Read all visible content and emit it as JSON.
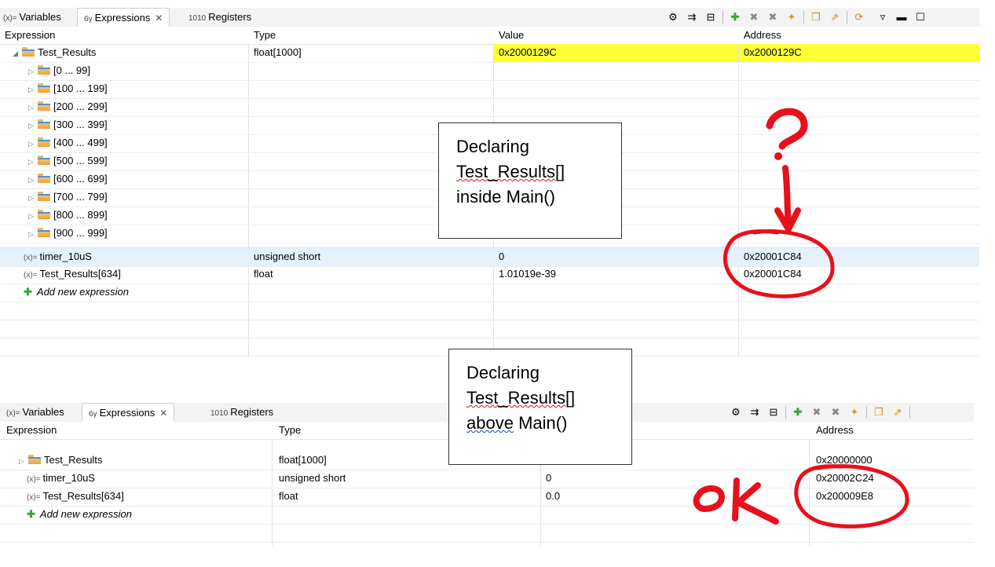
{
  "top_panel": {
    "tabs": [
      {
        "label": "Variables",
        "icon": "(x)="
      },
      {
        "label": "Expressions",
        "icon": "6γ"
      },
      {
        "label": "Registers",
        "icon": "1010"
      }
    ],
    "close_glyph": "✕",
    "columns": [
      "Expression",
      "Type",
      "Value",
      "Address"
    ],
    "rows": [
      {
        "expr": "Test_Results",
        "type": "float[1000]",
        "value": "0x2000129C",
        "address": "0x2000129C"
      },
      {
        "expr": "[0 ... 99]"
      },
      {
        "expr": "[100 ... 199]"
      },
      {
        "expr": "[200 ... 299]"
      },
      {
        "expr": "[300 ... 399]"
      },
      {
        "expr": "[400 ... 499]"
      },
      {
        "expr": "[500 ... 599]"
      },
      {
        "expr": "[600 ... 699]"
      },
      {
        "expr": "[700 ... 799]"
      },
      {
        "expr": "[800 ... 899]"
      },
      {
        "expr": "[900 ... 999]"
      },
      {
        "expr": "timer_10uS",
        "type": "unsigned short",
        "value": "0",
        "address": "0x20001C84"
      },
      {
        "expr": "Test_Results[634]",
        "type": "float",
        "value": "1.01019e-39",
        "address": "0x20001C84"
      }
    ],
    "add_label": "Add new expression"
  },
  "bottom_panel": {
    "tabs": [
      {
        "label": "Variables",
        "icon": "(x)="
      },
      {
        "label": "Expressions",
        "icon": "6γ"
      },
      {
        "label": "Registers",
        "icon": "1010"
      }
    ],
    "close_glyph": "✕",
    "columns": [
      "Expression",
      "Type",
      "",
      "Address"
    ],
    "rows": [
      {
        "expr": "Test_Results",
        "type": "float[1000]",
        "value": "",
        "address": "0x20000000"
      },
      {
        "expr": "timer_10uS",
        "type": "unsigned short",
        "value": "0",
        "address": "0x20002C24"
      },
      {
        "expr": "Test_Results[634]",
        "type": "float",
        "value": "0.0",
        "address": "0x200009E8"
      }
    ],
    "add_label": "Add new expression"
  },
  "annotations": {
    "note1": {
      "line1": "Declaring",
      "line2": "Test_Results[]",
      "line3": "inside Main()"
    },
    "note2": {
      "line1": "Declaring",
      "line2": "Test_Results[]",
      "line3": "above Main()"
    },
    "question": "?",
    "ok": "OK",
    "ink_color": "#e8101a",
    "highlight_color": "#ffff33"
  }
}
